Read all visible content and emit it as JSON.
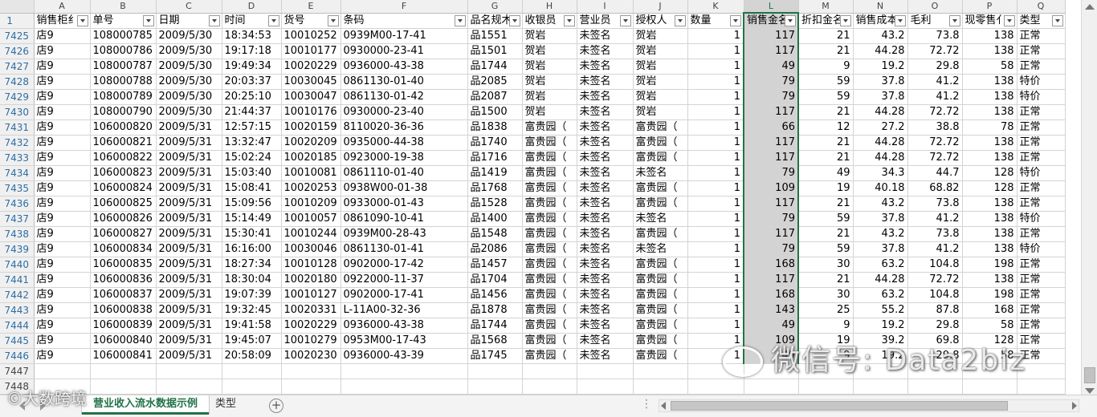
{
  "columns": [
    "A",
    "B",
    "C",
    "D",
    "E",
    "F",
    "G",
    "H",
    "I",
    "J",
    "K",
    "L",
    "M",
    "N",
    "O",
    "P",
    "Q"
  ],
  "header_row_number": "1",
  "headers": [
    "销售柜组",
    "单号",
    "日期",
    "时间",
    "货号",
    "条码",
    "品名规格",
    "收银员",
    "营业员",
    "授权人",
    "数量",
    "销售金额",
    "折扣金额",
    "销售成本",
    "毛利",
    "现零售价",
    "类型"
  ],
  "header_display": [
    "销售柜纟",
    "单号",
    "日期",
    "时间",
    "货号",
    "条码",
    "品名规木",
    "收银员",
    "营业员",
    "授权人",
    "数量",
    "销售金名",
    "折扣金名",
    "销售成本",
    "毛利",
    "现零售亻",
    "类型"
  ],
  "rows": [
    {
      "n": "7425",
      "c": [
        "店9",
        "108000785",
        "2009/5/30",
        "18:34:53",
        "10010252",
        "0939M00-17-41",
        "品1551",
        "贺岩",
        "未签名",
        "贺岩",
        "1",
        "117",
        "21",
        "43.2",
        "73.8",
        "138",
        "正常"
      ]
    },
    {
      "n": "7426",
      "c": [
        "店9",
        "108000786",
        "2009/5/30",
        "19:17:18",
        "10010177",
        "0930000-23-41",
        "品1501",
        "贺岩",
        "未签名",
        "贺岩",
        "1",
        "117",
        "21",
        "44.28",
        "72.72",
        "138",
        "正常"
      ]
    },
    {
      "n": "7427",
      "c": [
        "店9",
        "108000787",
        "2009/5/30",
        "19:49:34",
        "10020229",
        "0936000-43-38",
        "品1744",
        "贺岩",
        "未签名",
        "贺岩",
        "1",
        "49",
        "9",
        "19.2",
        "29.8",
        "58",
        "正常"
      ]
    },
    {
      "n": "7428",
      "c": [
        "店9",
        "108000788",
        "2009/5/30",
        "20:03:37",
        "10030045",
        "0861130-01-40",
        "品2085",
        "贺岩",
        "未签名",
        "贺岩",
        "1",
        "79",
        "59",
        "37.8",
        "41.2",
        "138",
        "特价"
      ]
    },
    {
      "n": "7429",
      "c": [
        "店9",
        "108000789",
        "2009/5/30",
        "20:25:10",
        "10030047",
        "0861130-01-42",
        "品2087",
        "贺岩",
        "未签名",
        "贺岩",
        "1",
        "79",
        "59",
        "37.8",
        "41.2",
        "138",
        "特价"
      ]
    },
    {
      "n": "7430",
      "c": [
        "店9",
        "108000790",
        "2009/5/30",
        "21:44:37",
        "10010176",
        "0930000-23-40",
        "品1500",
        "贺岩",
        "未签名",
        "贺岩",
        "1",
        "117",
        "21",
        "44.28",
        "72.72",
        "138",
        "正常"
      ]
    },
    {
      "n": "7431",
      "c": [
        "店9",
        "106000820",
        "2009/5/31",
        "12:57:15",
        "10020159",
        "8110020-36-36",
        "品1838",
        "富贵园（",
        "未签名",
        "富贵园（",
        "1",
        "66",
        "12",
        "27.2",
        "38.8",
        "78",
        "正常"
      ]
    },
    {
      "n": "7432",
      "c": [
        "店9",
        "106000821",
        "2009/5/31",
        "13:32:47",
        "10020209",
        "0935000-44-38",
        "品1740",
        "富贵园（",
        "未签名",
        "富贵园（",
        "1",
        "117",
        "21",
        "44.28",
        "72.72",
        "138",
        "正常"
      ]
    },
    {
      "n": "7433",
      "c": [
        "店9",
        "106000822",
        "2009/5/31",
        "15:02:24",
        "10020185",
        "0923000-19-38",
        "品1716",
        "富贵园（",
        "未签名",
        "富贵园（",
        "1",
        "117",
        "21",
        "44.28",
        "72.72",
        "138",
        "正常"
      ]
    },
    {
      "n": "7434",
      "c": [
        "店9",
        "106000823",
        "2009/5/31",
        "15:03:40",
        "10010081",
        "0861110-01-40",
        "品1419",
        "富贵园（",
        "未签名",
        "未签名",
        "1",
        "79",
        "49",
        "34.3",
        "44.7",
        "128",
        "特价"
      ]
    },
    {
      "n": "7435",
      "c": [
        "店9",
        "106000824",
        "2009/5/31",
        "15:08:41",
        "10020253",
        "0938W00-01-38",
        "品1768",
        "富贵园（",
        "未签名",
        "富贵园（",
        "1",
        "109",
        "19",
        "40.18",
        "68.82",
        "128",
        "正常"
      ]
    },
    {
      "n": "7436",
      "c": [
        "店9",
        "106000825",
        "2009/5/31",
        "15:09:56",
        "10010209",
        "0933000-01-43",
        "品1528",
        "富贵园（",
        "未签名",
        "富贵园（",
        "1",
        "117",
        "21",
        "43.2",
        "73.8",
        "138",
        "正常"
      ]
    },
    {
      "n": "7437",
      "c": [
        "店9",
        "106000826",
        "2009/5/31",
        "15:14:49",
        "10010057",
        "0861090-10-41",
        "品1400",
        "富贵园（",
        "未签名",
        "未签名",
        "1",
        "79",
        "59",
        "37.8",
        "41.2",
        "138",
        "特价"
      ]
    },
    {
      "n": "7438",
      "c": [
        "店9",
        "106000827",
        "2009/5/31",
        "15:30:41",
        "10010244",
        "0939M00-28-43",
        "品1548",
        "富贵园（",
        "未签名",
        "富贵园（",
        "1",
        "117",
        "21",
        "43.2",
        "73.8",
        "138",
        "正常"
      ]
    },
    {
      "n": "7439",
      "c": [
        "店9",
        "106000834",
        "2009/5/31",
        "16:16:00",
        "10030046",
        "0861130-01-41",
        "品2086",
        "富贵园（",
        "未签名",
        "未签名",
        "1",
        "79",
        "59",
        "37.8",
        "41.2",
        "138",
        "特价"
      ]
    },
    {
      "n": "7440",
      "c": [
        "店9",
        "106000835",
        "2009/5/31",
        "18:27:34",
        "10010128",
        "0902000-17-42",
        "品1457",
        "富贵园（",
        "未签名",
        "富贵园（",
        "1",
        "168",
        "30",
        "63.2",
        "104.8",
        "198",
        "正常"
      ]
    },
    {
      "n": "7441",
      "c": [
        "店9",
        "106000836",
        "2009/5/31",
        "18:30:04",
        "10020180",
        "0922000-11-37",
        "品1704",
        "富贵园（",
        "未签名",
        "富贵园（",
        "1",
        "117",
        "21",
        "44.28",
        "72.72",
        "138",
        "正常"
      ]
    },
    {
      "n": "7442",
      "c": [
        "店9",
        "106000837",
        "2009/5/31",
        "19:07:39",
        "10010127",
        "0902000-17-41",
        "品1456",
        "富贵园（",
        "未签名",
        "富贵园（",
        "1",
        "168",
        "30",
        "63.2",
        "104.8",
        "198",
        "正常"
      ]
    },
    {
      "n": "7443",
      "c": [
        "店9",
        "106000838",
        "2009/5/31",
        "19:32:45",
        "10020331",
        "L-11A00-32-36",
        "品1878",
        "富贵园（",
        "未签名",
        "富贵园（",
        "1",
        "143",
        "25",
        "55.2",
        "87.8",
        "168",
        "正常"
      ]
    },
    {
      "n": "7444",
      "c": [
        "店9",
        "106000839",
        "2009/5/31",
        "19:41:58",
        "10020229",
        "0936000-43-38",
        "品1744",
        "富贵园（",
        "未签名",
        "富贵园（",
        "1",
        "49",
        "9",
        "19.2",
        "29.8",
        "58",
        "正常"
      ]
    },
    {
      "n": "7445",
      "c": [
        "店9",
        "106000840",
        "2009/5/31",
        "19:45:07",
        "10010279",
        "0953M00-17-43",
        "品1568",
        "富贵园（",
        "未签名",
        "富贵园（",
        "1",
        "109",
        "19",
        "39.2",
        "69.8",
        "128",
        "正常"
      ]
    },
    {
      "n": "7446",
      "c": [
        "店9",
        "106000841",
        "2009/5/31",
        "20:58:09",
        "10020230",
        "0936000-43-39",
        "品1745",
        "富贵园（",
        "未签名",
        "富贵园（",
        "1",
        "49",
        "9",
        "19.2",
        "29.8",
        "58",
        "正常"
      ]
    }
  ],
  "empty_rows": [
    "7447",
    "7448"
  ],
  "sheet_tabs": [
    "营业收入流水数据示例",
    "类型"
  ],
  "active_tab_index": 0,
  "add_sheet_symbol": "+",
  "watermark_right": "微信号: Data2biz",
  "watermark_left": "©大数跨境",
  "colors": {
    "accent": "#217346",
    "header_bg": "#f0f0f0",
    "grid_line": "#d4d4d4",
    "row_number": "#2e6da4",
    "selected_column": "#d3d3d3"
  }
}
